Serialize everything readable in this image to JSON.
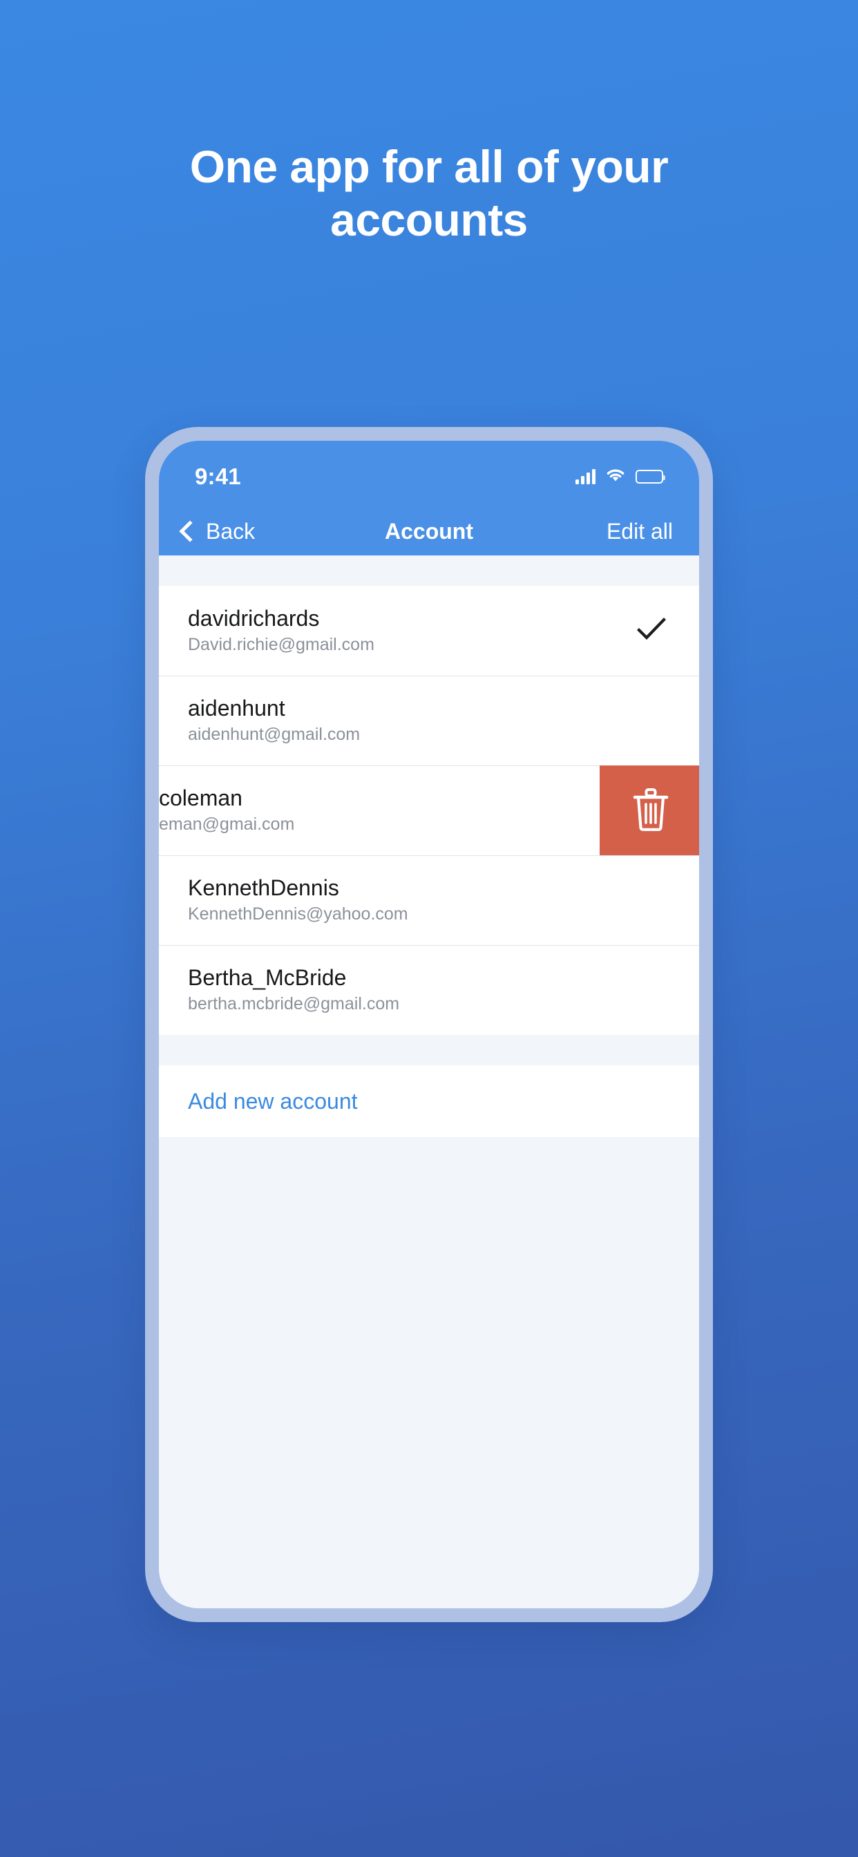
{
  "page": {
    "headline": "One app for all of your accounts",
    "background_top_color": "#3a88e2",
    "background_bottom_color": "#3458ab",
    "phone_frame_color": "#aec0e4"
  },
  "status_bar": {
    "time": "9:41",
    "signal_icon": "cellular-signal-icon",
    "wifi_icon": "wifi-icon",
    "battery_icon": "battery-full-icon"
  },
  "nav_bar": {
    "back_label": "Back",
    "back_icon": "chevron-left-icon",
    "title": "Account",
    "edit_label": "Edit all",
    "background_color": "#4a90e6"
  },
  "accounts": [
    {
      "name": "davidrichards",
      "email": "David.richie@gmail.com",
      "selected": true,
      "check_icon": "checkmark-icon"
    },
    {
      "name": "aidenhunt",
      "email": "aidenhunt@gmail.com",
      "selected": false
    },
    {
      "name": "coleman",
      "email": "eman@gmai.com",
      "selected": false,
      "swiped": true,
      "delete_icon": "trash-icon",
      "delete_color": "#d4604a"
    },
    {
      "name": "KennethDennis",
      "email": "KennethDennis@yahoo.com",
      "selected": false
    },
    {
      "name": "Bertha_McBride",
      "email": "bertha.mcbride@gmail.com",
      "selected": false
    }
  ],
  "add_account": {
    "label": "Add new account",
    "color": "#3a8ae0"
  }
}
